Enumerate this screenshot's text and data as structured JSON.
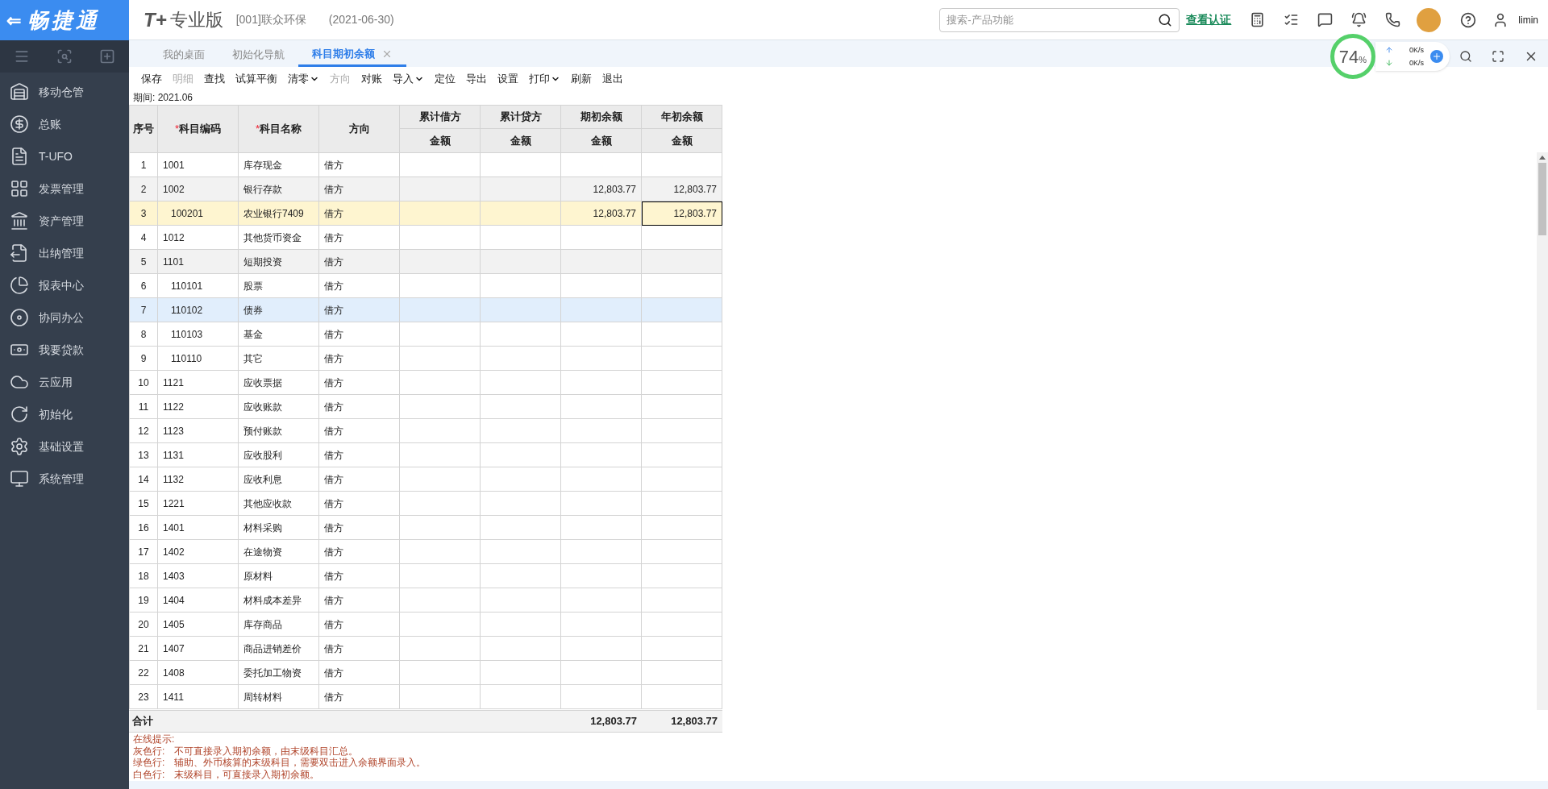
{
  "brand": {
    "back": "⇐",
    "name": "畅捷通"
  },
  "header": {
    "product_mark": "T+",
    "product": "专业版",
    "company": "[001]联众环保",
    "date": "(2021-06-30)",
    "search": {
      "placeholder": "搜索-产品功能"
    },
    "auth_link": "查看认证",
    "user": "limin"
  },
  "sidebar": {
    "items": [
      {
        "label": "移动仓管"
      },
      {
        "label": "总账"
      },
      {
        "label": "T-UFO"
      },
      {
        "label": "发票管理"
      },
      {
        "label": "资产管理"
      },
      {
        "label": "出纳管理"
      },
      {
        "label": "报表中心"
      },
      {
        "label": "协同办公"
      },
      {
        "label": "我要贷款"
      },
      {
        "label": "云应用"
      },
      {
        "label": "初始化"
      },
      {
        "label": "基础设置"
      },
      {
        "label": "系统管理"
      }
    ]
  },
  "tabs": [
    {
      "label": "我的桌面",
      "selected": false,
      "closable": false
    },
    {
      "label": "初始化导航",
      "selected": false,
      "closable": false
    },
    {
      "label": "科目期初余额",
      "selected": true,
      "closable": true
    }
  ],
  "monitor": {
    "percent": "74",
    "unit": "%",
    "upload": "0K/s",
    "download": "0K/s"
  },
  "toolbar": [
    {
      "label": "保存",
      "disabled": false,
      "dropdown": false
    },
    {
      "label": "明细",
      "disabled": true,
      "dropdown": false
    },
    {
      "label": "查找",
      "disabled": false,
      "dropdown": false
    },
    {
      "label": "试算平衡",
      "disabled": false,
      "dropdown": false
    },
    {
      "label": "清零",
      "disabled": false,
      "dropdown": true
    },
    {
      "label": "方向",
      "disabled": true,
      "dropdown": false
    },
    {
      "label": "对账",
      "disabled": false,
      "dropdown": false
    },
    {
      "label": "导入",
      "disabled": false,
      "dropdown": true
    },
    {
      "label": "定位",
      "disabled": false,
      "dropdown": false
    },
    {
      "label": "导出",
      "disabled": false,
      "dropdown": false
    },
    {
      "label": "设置",
      "disabled": false,
      "dropdown": false
    },
    {
      "label": "打印",
      "disabled": false,
      "dropdown": true
    },
    {
      "label": "刷新",
      "disabled": false,
      "dropdown": false
    },
    {
      "label": "退出",
      "disabled": false,
      "dropdown": false
    }
  ],
  "period": "期间: 2021.06",
  "table": {
    "columns": [
      {
        "label": "序号"
      },
      {
        "label": "科目编码",
        "mark": "*"
      },
      {
        "label": "科目名称",
        "mark": "*"
      },
      {
        "label": "方向"
      }
    ],
    "amount_groups": [
      {
        "label": "累计借方",
        "sub": "金额"
      },
      {
        "label": "累计贷方",
        "sub": "金额"
      },
      {
        "label": "期初余额",
        "sub": "金额"
      },
      {
        "label": "年初余额",
        "sub": "金额"
      }
    ],
    "rows": [
      {
        "no": "1",
        "code": "1001",
        "name": "库存现金",
        "direction": "借方",
        "kind": "leaf",
        "selected": false,
        "hovered": false
      },
      {
        "no": "2",
        "code": "1002",
        "name": "银行存款",
        "direction": "借方",
        "kind": "summary",
        "selected": false,
        "hovered": false,
        "period_start": "12,803.77",
        "year_start": "12,803.77",
        "children": [
          {
            "no": "3",
            "code": "100201",
            "name": "农业银行7409",
            "direction": "借方",
            "kind": "leaf",
            "selected": true,
            "hovered": false,
            "period_start": "12,803.77",
            "year_start": "12,803.77",
            "focused": true
          }
        ]
      },
      {
        "no": "4",
        "code": "1012",
        "name": "其他货币资金",
        "direction": "借方",
        "kind": "leaf",
        "selected": false,
        "hovered": false
      },
      {
        "no": "5",
        "code": "1101",
        "name": "短期投资",
        "direction": "借方",
        "kind": "summary",
        "selected": false,
        "hovered": false,
        "children": [
          {
            "no": "6",
            "code": "110101",
            "name": "股票",
            "direction": "借方",
            "kind": "leaf",
            "selected": false,
            "hovered": false
          },
          {
            "no": "7",
            "code": "110102",
            "name": "债券",
            "direction": "借方",
            "kind": "leaf",
            "selected": false,
            "hovered": true
          },
          {
            "no": "8",
            "code": "110103",
            "name": "基金",
            "direction": "借方",
            "kind": "leaf",
            "selected": false,
            "hovered": false
          },
          {
            "no": "9",
            "code": "110110",
            "name": "其它",
            "direction": "借方",
            "kind": "leaf",
            "selected": false,
            "hovered": false
          }
        ]
      },
      {
        "no": "10",
        "code": "1121",
        "name": "应收票据",
        "direction": "借方",
        "kind": "leaf",
        "selected": false,
        "hovered": false
      },
      {
        "no": "11",
        "code": "1122",
        "name": "应收账款",
        "direction": "借方",
        "kind": "leaf",
        "selected": false,
        "hovered": false
      },
      {
        "no": "12",
        "code": "1123",
        "name": "预付账款",
        "direction": "借方",
        "kind": "leaf",
        "selected": false,
        "hovered": false
      },
      {
        "no": "13",
        "code": "1131",
        "name": "应收股利",
        "direction": "借方",
        "kind": "leaf",
        "selected": false,
        "hovered": false
      },
      {
        "no": "14",
        "code": "1132",
        "name": "应收利息",
        "direction": "借方",
        "kind": "leaf",
        "selected": false,
        "hovered": false
      },
      {
        "no": "15",
        "code": "1221",
        "name": "其他应收款",
        "direction": "借方",
        "kind": "leaf",
        "selected": false,
        "hovered": false
      },
      {
        "no": "16",
        "code": "1401",
        "name": "材料采购",
        "direction": "借方",
        "kind": "leaf",
        "selected": false,
        "hovered": false
      },
      {
        "no": "17",
        "code": "1402",
        "name": "在途物资",
        "direction": "借方",
        "kind": "leaf",
        "selected": false,
        "hovered": false
      },
      {
        "no": "18",
        "code": "1403",
        "name": "原材料",
        "direction": "借方",
        "kind": "leaf",
        "selected": false,
        "hovered": false
      },
      {
        "no": "19",
        "code": "1404",
        "name": "材料成本差异",
        "direction": "借方",
        "kind": "leaf",
        "selected": false,
        "hovered": false
      },
      {
        "no": "20",
        "code": "1405",
        "name": "库存商品",
        "direction": "借方",
        "kind": "leaf",
        "selected": false,
        "hovered": false
      },
      {
        "no": "21",
        "code": "1407",
        "name": "商品进销差价",
        "direction": "借方",
        "kind": "leaf",
        "selected": false,
        "hovered": false
      },
      {
        "no": "22",
        "code": "1408",
        "name": "委托加工物资",
        "direction": "借方",
        "kind": "leaf",
        "selected": false,
        "hovered": false
      },
      {
        "no": "23",
        "code": "1411",
        "name": "周转材料",
        "direction": "借方",
        "kind": "leaf",
        "selected": false,
        "hovered": false
      }
    ],
    "total": {
      "label": "合计",
      "period_start": "12,803.77",
      "year_start": "12,803.77"
    }
  },
  "hints": {
    "title": "在线提示:",
    "lines": [
      {
        "label": "灰色行:",
        "text": "不可直接录入期初余额，由末级科目汇总。"
      },
      {
        "label": "绿色行:",
        "text": "辅助、外币核算的末级科目，需要双击进入余额界面录入。"
      },
      {
        "label": "白色行:",
        "text": "末级科目，可直接录入期初余额。"
      }
    ]
  }
}
